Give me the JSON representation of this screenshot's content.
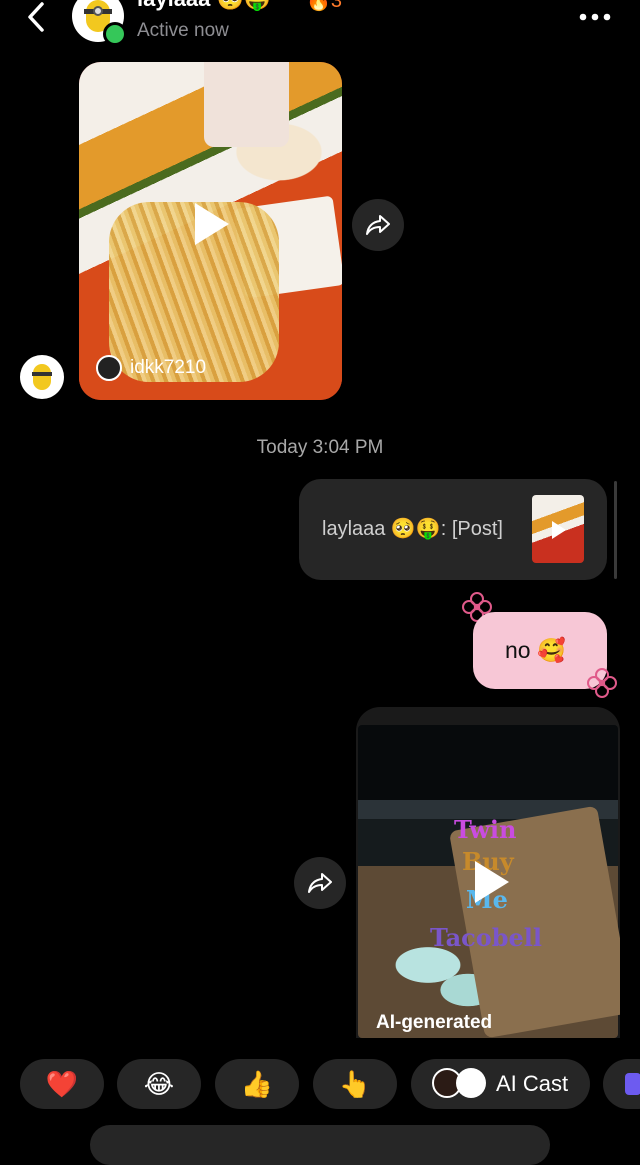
{
  "header": {
    "name": "laylaaa 🥺🤑",
    "status": "Active now",
    "streak": "🔥3",
    "icons": {
      "back": "chevron-left-icon",
      "more": "more-horizontal-icon"
    }
  },
  "messages": {
    "incoming_video": {
      "creator": "idkk7210"
    },
    "timestamp": "Today 3:04 PM",
    "shared_post": {
      "text": "laylaaa 🥺🤑: [Post]"
    },
    "reply": {
      "text": "no 🥰"
    },
    "outgoing_video": {
      "overlay_lines": [
        "Twin",
        "Buy",
        "Me",
        "Tacobell"
      ],
      "label": "AI-generated"
    }
  },
  "reactions": {
    "emojis": [
      "❤️",
      "😂",
      "👍",
      "👆"
    ],
    "ai_cast_label": "AI Cast"
  },
  "colors": {
    "bubble_dark": "#262626",
    "bubble_pink": "#f7c7d6",
    "online": "#35c759"
  }
}
